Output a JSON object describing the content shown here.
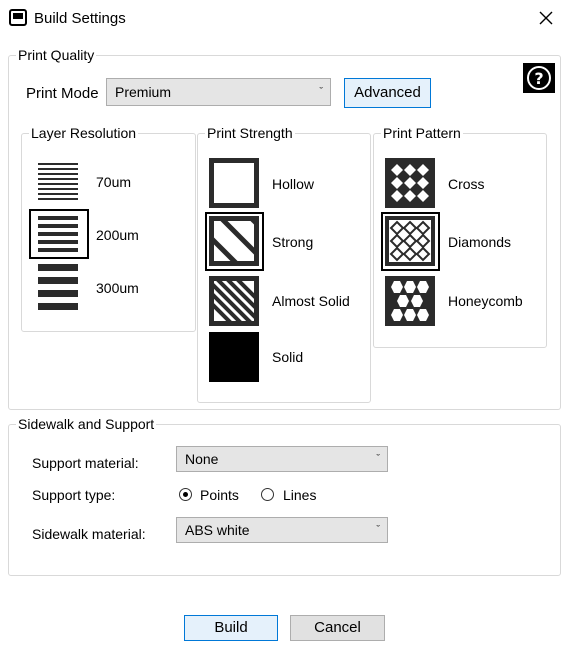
{
  "window": {
    "title": "Build Settings",
    "close_icon": "close-icon",
    "app_icon": "printer-icon"
  },
  "print_quality": {
    "legend": "Print Quality",
    "mode_label": "Print Mode",
    "mode_value": "Premium",
    "advanced_label": "Advanced",
    "help_icon": "help-icon",
    "layer_resolution": {
      "legend": "Layer Resolution",
      "options": [
        {
          "label": "70um",
          "selected": false
        },
        {
          "label": "200um",
          "selected": true
        },
        {
          "label": "300um",
          "selected": false
        }
      ]
    },
    "print_strength": {
      "legend": "Print Strength",
      "options": [
        {
          "label": "Hollow",
          "selected": false
        },
        {
          "label": "Strong",
          "selected": true
        },
        {
          "label": "Almost Solid",
          "selected": false
        },
        {
          "label": "Solid",
          "selected": false
        }
      ]
    },
    "print_pattern": {
      "legend": "Print Pattern",
      "options": [
        {
          "label": "Cross",
          "selected": false
        },
        {
          "label": "Diamonds",
          "selected": true
        },
        {
          "label": "Honeycomb",
          "selected": false
        }
      ]
    }
  },
  "sidewalk_support": {
    "legend": "Sidewalk and Support",
    "support_material_label": "Support material:",
    "support_material_value": "None",
    "support_type_label": "Support type:",
    "support_type_options": [
      {
        "label": "Points",
        "selected": true
      },
      {
        "label": "Lines",
        "selected": false
      }
    ],
    "sidewalk_material_label": "Sidewalk material:",
    "sidewalk_material_value": "ABS white"
  },
  "footer": {
    "build_label": "Build",
    "cancel_label": "Cancel"
  },
  "colors": {
    "accent_border": "#0078d7",
    "accent_fill": "#e5f1fb",
    "icon_dark": "#2b2b2b"
  }
}
